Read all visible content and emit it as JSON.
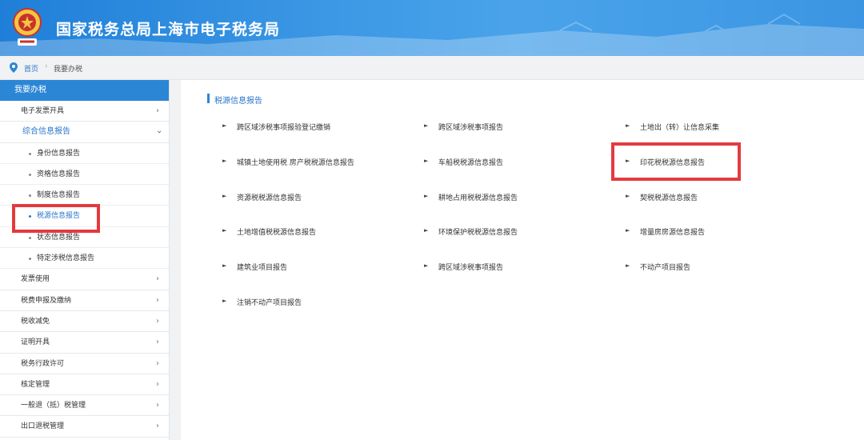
{
  "header": {
    "title": "国家税务总局上海市电子税务局",
    "emblem_text": "中国税务",
    "bg_color": "#2b86d6"
  },
  "breadcrumb": {
    "home": "首页",
    "separator": "›",
    "current": "我要办税"
  },
  "sidebar": {
    "title": "我要办税",
    "items": [
      {
        "label": "电子发票开具"
      },
      {
        "label": "综合信息报告"
      },
      {
        "label": "发票使用"
      },
      {
        "label": "税费申报及缴纳"
      },
      {
        "label": "税收减免"
      },
      {
        "label": "证明开具"
      },
      {
        "label": "税务行政许可"
      },
      {
        "label": "核定管理"
      },
      {
        "label": "一般退（抵）税管理"
      },
      {
        "label": "出口退税管理"
      }
    ],
    "subitems": [
      {
        "label": "身份信息报告"
      },
      {
        "label": "资格信息报告"
      },
      {
        "label": "制度信息报告"
      },
      {
        "label": "税源信息报告"
      },
      {
        "label": "状态信息报告"
      },
      {
        "label": "特定涉税信息报告"
      }
    ],
    "chevron": "›"
  },
  "main": {
    "section_title": "税源信息报告",
    "links": [
      "跨区域涉税事项报验登记缴销",
      "跨区域涉税事项报告",
      "土地出（转）让信息采集",
      "城镇土地使用税 房产税税源信息报告",
      "车船税税源信息报告",
      "印花税税源信息报告",
      "资源税税源信息报告",
      "耕地占用税税源信息报告",
      "契税税源信息报告",
      "土地增值税税源信息报告",
      "环境保护税税源信息报告",
      "增量房房源信息报告",
      "建筑业项目报告",
      "跨区域涉税事项报告",
      "不动产项目报告",
      "注销不动产项目报告"
    ],
    "bullet": "►"
  },
  "colors": {
    "accent": "#2b86d6",
    "link_active": "#2a76c8",
    "highlight": "#e33a3f"
  }
}
